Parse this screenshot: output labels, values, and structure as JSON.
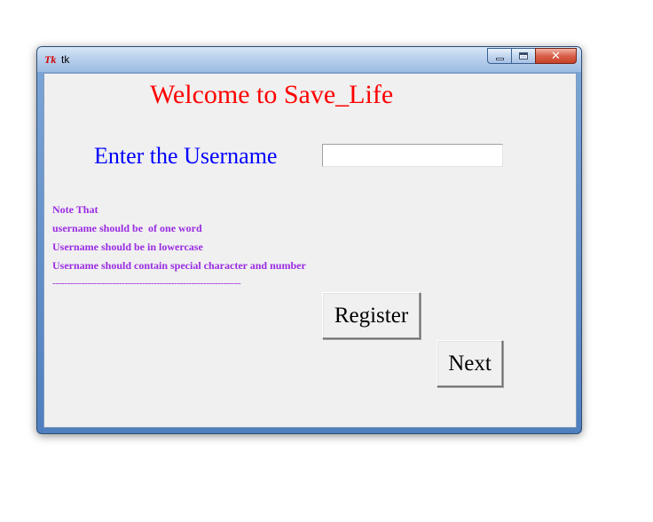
{
  "window": {
    "title": "tk",
    "logo_text": "Tk",
    "controls": {
      "minimize_glyph": "",
      "maximize_glyph": "",
      "close_glyph": "✕"
    }
  },
  "form": {
    "heading": "Welcome to Save_Life",
    "username_label": "Enter the Username",
    "username_value": "",
    "notes": [
      "Note That",
      "username should be  of one word",
      "Username should be in lowercase",
      "Username should contain special character and number"
    ],
    "separator": "-----------------------------------------------------------------",
    "register_label": "Register",
    "next_label": "Next"
  },
  "colors": {
    "heading": "#ff0000",
    "label": "#0000ff",
    "notes": "#9a2be2",
    "client_bg": "#f0f0f0"
  }
}
